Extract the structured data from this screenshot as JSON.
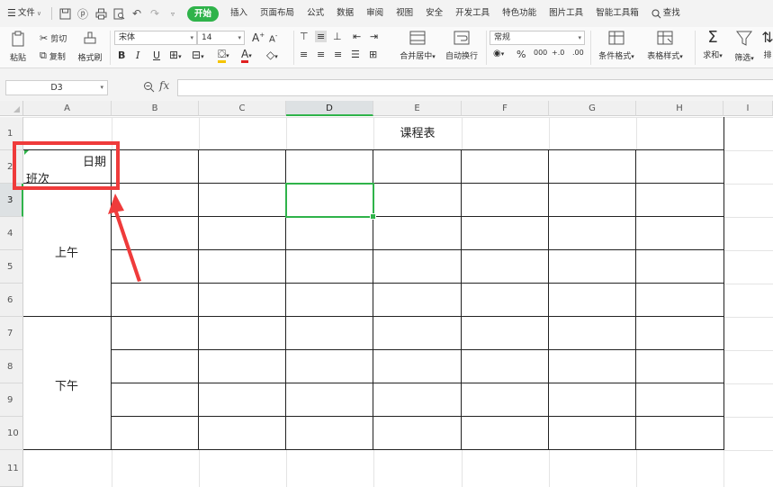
{
  "menubar": {
    "file": "文件",
    "tabs": [
      "开始",
      "插入",
      "页面布局",
      "公式",
      "数据",
      "审阅",
      "视图",
      "安全",
      "开发工具",
      "特色功能",
      "图片工具",
      "智能工具箱"
    ],
    "search": "查找",
    "active_tab": "开始"
  },
  "ribbon": {
    "paste": "粘贴",
    "cut": "剪切",
    "copy": "复制",
    "format_painter": "格式刷",
    "font_name": "宋体",
    "font_size": "14",
    "grow": "A",
    "shrink": "A",
    "bold": "B",
    "italic": "I",
    "underline": "U",
    "merge_center": "合并居中",
    "wrap_text": "自动换行",
    "number_format": "常规",
    "percent": "%",
    "thousands": "000",
    "inc_decimal": "+.0",
    "dec_decimal": ".00",
    "cond_format": "条件格式",
    "table_style": "表格样式",
    "sum": "求和",
    "filter": "筛选",
    "sort": "排"
  },
  "formula_bar": {
    "cell_ref": "D3",
    "fx": "fx",
    "formula": ""
  },
  "grid": {
    "columns": [
      "A",
      "B",
      "C",
      "D",
      "E",
      "F",
      "G",
      "H",
      "I"
    ],
    "rows": [
      "1",
      "2",
      "3",
      "4",
      "5",
      "6",
      "7",
      "8",
      "9",
      "10",
      "11"
    ],
    "selected_column": "D",
    "selected_row": "3"
  },
  "sheet": {
    "title": "课程表",
    "header_date": "日期",
    "header_class": "班次",
    "morning": "上午",
    "afternoon": "下午"
  },
  "colors": {
    "accent": "#2fb34a",
    "annotation": "#ef3b3b"
  }
}
